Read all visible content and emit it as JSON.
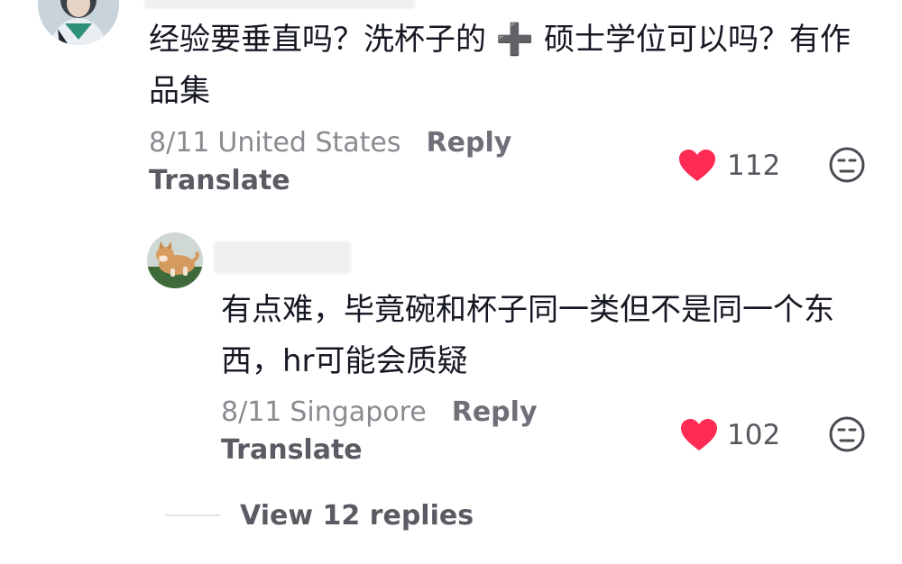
{
  "comments": [
    {
      "text": "经验要垂直吗？洗杯子的 ➕ 硕士学位可以吗？有作\n品集",
      "date": "8/11",
      "location": "United States",
      "reply_label": "Reply",
      "translate_label": "Translate",
      "likes": "112",
      "avatar_icon": "user-avatar-person"
    },
    {
      "text": "有点难，毕竟碗和杯子同一类但不是同一个东\n西，hr可能会质疑",
      "date": "8/11",
      "location": "Singapore",
      "reply_label": "Reply",
      "translate_label": "Translate",
      "likes": "102",
      "avatar_icon": "user-avatar-shiba-dog"
    }
  ],
  "view_replies_label": "View 12 replies",
  "colors": {
    "heart": "#fe2c55",
    "text": "#161823",
    "meta": "#8a8b91"
  }
}
